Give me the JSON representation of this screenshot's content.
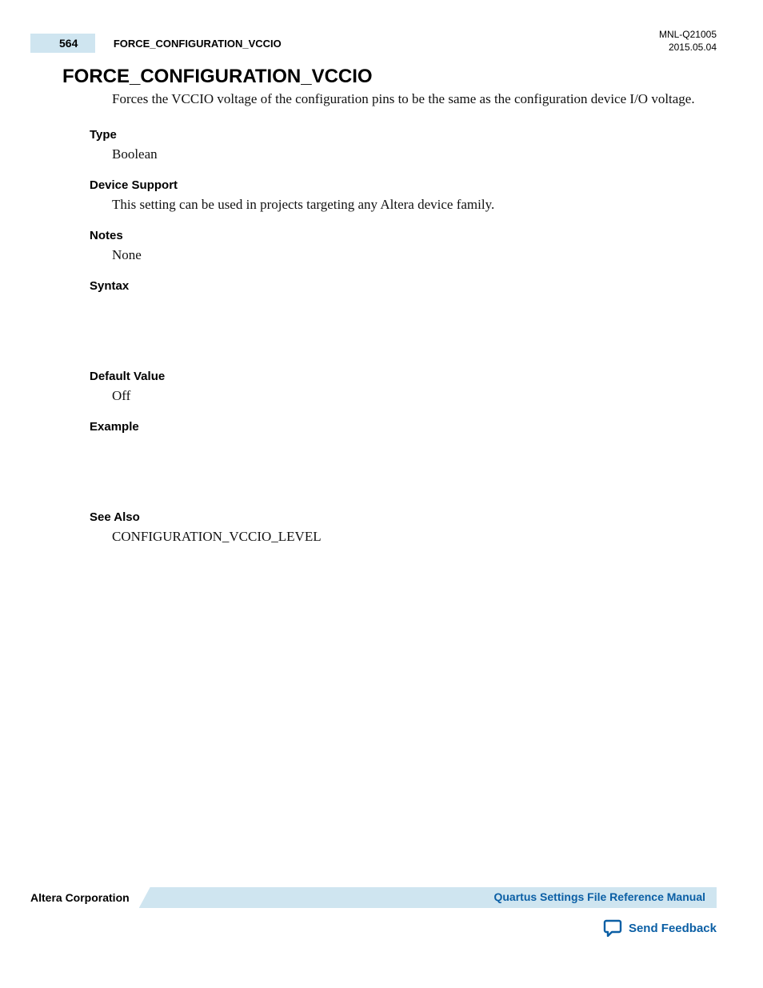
{
  "header": {
    "page_number": "564",
    "running_title": "FORCE_CONFIGURATION_VCCIO",
    "doc_id": "MNL-Q21005",
    "date": "2015.05.04"
  },
  "main": {
    "title": "FORCE_CONFIGURATION_VCCIO",
    "description": "Forces the VCCIO voltage of the configuration pins to be the same as the configuration device I/O voltage.",
    "sections": {
      "type_label": "Type",
      "type_value": "Boolean",
      "device_support_label": "Device Support",
      "device_support_value": "This setting can be used in projects targeting any Altera device family.",
      "notes_label": "Notes",
      "notes_value": "None",
      "syntax_label": "Syntax",
      "default_value_label": "Default Value",
      "default_value_value": "Off",
      "example_label": "Example",
      "see_also_label": "See Also",
      "see_also_value": "CONFIGURATION_VCCIO_LEVEL"
    }
  },
  "footer": {
    "company": "Altera Corporation",
    "manual_link": "Quartus Settings File Reference Manual",
    "feedback_link": "Send Feedback"
  }
}
